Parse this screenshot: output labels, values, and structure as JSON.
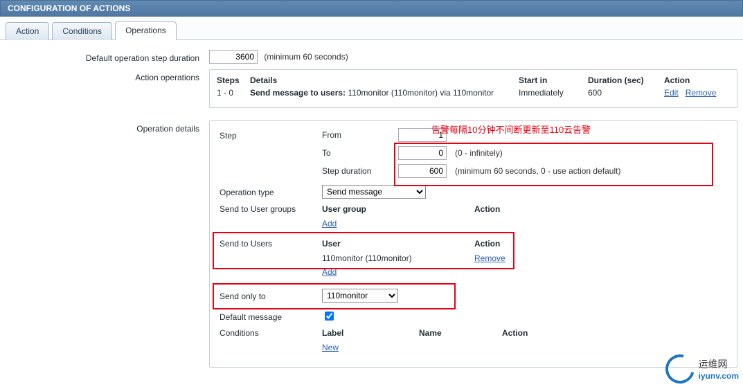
{
  "header": {
    "title": "CONFIGURATION OF ACTIONS"
  },
  "tabs": {
    "items": [
      "Action",
      "Conditions",
      "Operations"
    ],
    "active": 2
  },
  "labels": {
    "default_step_duration": "Default operation step duration",
    "action_operations": "Action operations",
    "operation_details": "Operation details",
    "step": "Step",
    "from": "From",
    "to": "To",
    "step_duration": "Step duration",
    "operation_type": "Operation type",
    "send_to_user_groups": "Send to User groups",
    "send_to_users": "Send to Users",
    "send_only_to": "Send only to",
    "default_message": "Default message",
    "conditions": "Conditions",
    "user_group": "User group",
    "user": "User",
    "action": "Action",
    "label_col": "Label",
    "name_col": "Name"
  },
  "values": {
    "default_step_duration": "3600",
    "step_from": "1",
    "step_to": "0",
    "step_duration": "600",
    "operation_type": "Send message",
    "send_only_to": "110monitor",
    "default_message_checked": true
  },
  "hints": {
    "default_step_duration": "(minimum 60 seconds)",
    "to": "(0 - infinitely)",
    "step_duration": "(minimum 60 seconds, 0 - use action default)"
  },
  "ops_table": {
    "headers": {
      "steps": "Steps",
      "details": "Details",
      "start": "Start in",
      "duration": "Duration (sec)",
      "action": "Action"
    },
    "rows": [
      {
        "steps": "1 - 0",
        "details_prefix": "Send message to users:",
        "details_rest": " 110monitor (110monitor) via 110monitor",
        "start": "Immediately",
        "duration": "600"
      }
    ]
  },
  "users_table": {
    "rows": [
      {
        "user": "110monitor (110monitor)"
      }
    ]
  },
  "links": {
    "edit": "Edit",
    "remove": "Remove",
    "add": "Add",
    "new": "New"
  },
  "annotation": "告警每隔10分钟不间断更新至110云告警",
  "watermark": {
    "line1": "运维网",
    "line2": "iyunv.com"
  }
}
